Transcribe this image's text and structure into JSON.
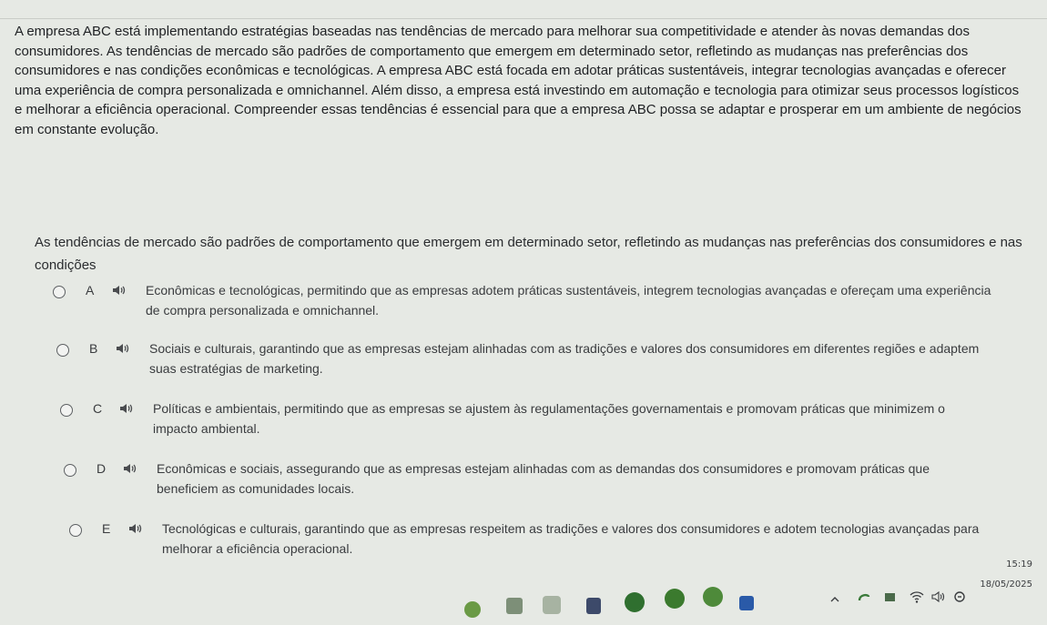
{
  "passage": "A empresa ABC está implementando estratégias baseadas nas tendências de mercado para melhorar sua competitividade e atender às novas demandas dos consumidores. As tendências de mercado são padrões de comportamento que emergem em determinado setor, refletindo as mudanças nas preferências dos consumidores e nas condições econômicas e tecnológicas. A empresa ABC está focada em adotar práticas sustentáveis, integrar tecnologias avançadas e oferecer uma experiência de compra personalizada e omnichannel. Além disso, a empresa está investindo em automação e tecnologia para otimizar seus processos logísticos e melhorar a eficiência operacional. Compreender essas tendências é essencial para que a empresa ABC possa se adaptar e prosperar em um ambiente de negócios em constante evolução.",
  "question": "As tendências de mercado são padrões de comportamento que emergem em determinado setor, refletindo as mudanças nas preferências dos consumidores e nas condições",
  "options": [
    {
      "letter": "A",
      "text": "Econômicas e tecnológicas, permitindo que as empresas adotem práticas sustentáveis, integrem tecnologias avançadas e ofereçam uma experiência de compra personalizada e omnichannel."
    },
    {
      "letter": "B",
      "text": "Sociais e culturais, garantindo que as empresas estejam alinhadas com as tradições e valores dos consumidores em diferentes regiões e adaptem suas estratégias de marketing."
    },
    {
      "letter": "C",
      "text": "Políticas e ambientais, permitindo que as empresas se ajustem às regulamentações governamentais e promovam práticas que minimizem o impacto ambiental."
    },
    {
      "letter": "D",
      "text": "Econômicas e sociais, assegurando que as empresas estejam alinhadas com as demandas dos consumidores e promovam práticas que beneficiem as comunidades locais."
    },
    {
      "letter": "E",
      "text": "Tecnológicas e culturais, garantindo que as empresas respeitem as tradições e valores dos consumidores e adotem tecnologias avançadas para melhorar a eficiência operacional."
    }
  ],
  "clock": {
    "time": "15:19",
    "date": "18/05/2025"
  },
  "colors": {
    "background": "#e6e9e4",
    "text": "#2b2d2f"
  },
  "icons": [
    "speaker-icon",
    "chevron-up-icon",
    "wifi-icon",
    "volume-icon",
    "battery-icon"
  ]
}
